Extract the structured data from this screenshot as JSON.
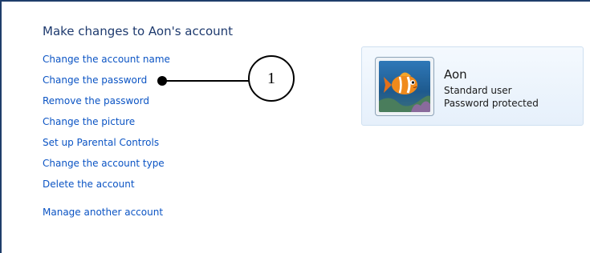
{
  "page": {
    "title": "Make changes to Aon's account"
  },
  "tasks": [
    {
      "label": "Change the account name"
    },
    {
      "label": "Change the password"
    },
    {
      "label": "Remove the password"
    },
    {
      "label": "Change the picture"
    },
    {
      "label": "Set up Parental Controls"
    },
    {
      "label": "Change the account type"
    },
    {
      "label": "Delete the account"
    },
    {
      "label": "Manage another account"
    }
  ],
  "callout": {
    "number": "1"
  },
  "account": {
    "name": "Aon",
    "type": "Standard user",
    "status": "Password protected",
    "picture_icon": "fish-icon"
  },
  "colors": {
    "link": "#0b54c4",
    "title": "#1e3a6e",
    "frame_border": "#1f3e6b",
    "card_border": "#cfe0f1"
  }
}
